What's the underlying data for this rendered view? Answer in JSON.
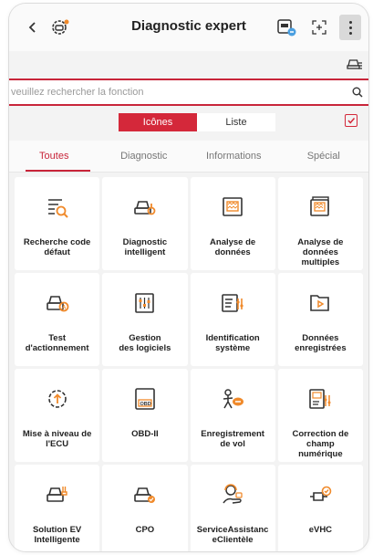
{
  "header": {
    "back_icon": "chevron-left-icon",
    "logo_icon": "car-gear-logo-icon",
    "title": "Diagnostic expert",
    "vci_icon": "vci-device-icon",
    "scan_icon": "scan-icon",
    "more_icon": "more-vertical-icon"
  },
  "search": {
    "placeholder": "veuillez rechercher la fonction",
    "icon": "search-icon"
  },
  "view_toggle": {
    "icons_label": "Icônes",
    "list_label": "Liste"
  },
  "tabs": [
    {
      "label": "Toutes",
      "active": true
    },
    {
      "label": "Diagnostic",
      "active": false
    },
    {
      "label": "Informations",
      "active": false
    },
    {
      "label": "Spécial",
      "active": false
    }
  ],
  "functions": [
    {
      "label": "Recherche code\ndéfaut",
      "icon": "fault-code-search-icon"
    },
    {
      "label": "Diagnostic\nintelligent",
      "icon": "smart-diagnostic-icon"
    },
    {
      "label": "Analyse de\ndonnées",
      "icon": "data-analysis-icon"
    },
    {
      "label": "Analyse de\ndonnées\nmultiples",
      "icon": "multi-data-analysis-icon"
    },
    {
      "label": "Test\nd'actionnement",
      "icon": "actuation-test-icon"
    },
    {
      "label": "Gestion\ndes logiciels",
      "icon": "software-management-icon"
    },
    {
      "label": "Identification\nsystème",
      "icon": "system-identification-icon"
    },
    {
      "label": "Données\nenregistrées",
      "icon": "recorded-data-icon"
    },
    {
      "label": "Mise à niveau de\nl'ECU",
      "icon": "ecu-upgrade-icon"
    },
    {
      "label": "OBD-II",
      "icon": "obd-icon"
    },
    {
      "label": "Enregistrement\nde vol",
      "icon": "flight-record-icon"
    },
    {
      "label": "Correction de\nchamp\nnumérique",
      "icon": "field-correction-icon"
    },
    {
      "label": "Solution EV\nIntelligente",
      "icon": "ev-solution-icon"
    },
    {
      "label": "CPO",
      "icon": "cpo-icon"
    },
    {
      "label": "ServiceAssistanc\neClientèle",
      "icon": "customer-service-icon"
    },
    {
      "label": "eVHC",
      "icon": "evhc-icon"
    }
  ],
  "obd_text": "OBD",
  "colors": {
    "accent": "#d4283a",
    "icon_orange": "#f08a2b",
    "icon_gray": "#333333"
  }
}
